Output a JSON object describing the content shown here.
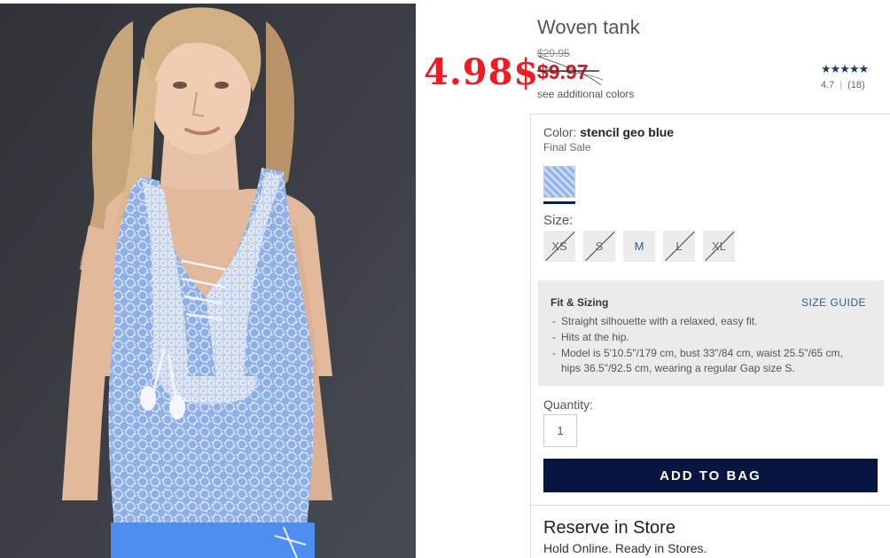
{
  "product": {
    "title": "Woven tank",
    "original_price": "$29.95",
    "sale_price": "$9.97",
    "handwritten_price": "4.98$",
    "additional_colors_link": "see additional colors",
    "rating": {
      "stars_value": 4.7,
      "stars_display": "★★★★★",
      "score": "4.7",
      "count": "(18)"
    }
  },
  "color": {
    "label": "Color:",
    "name": "stencil geo blue",
    "note": "Final Sale"
  },
  "size": {
    "label": "Size:",
    "options": [
      {
        "label": "XS",
        "available": false
      },
      {
        "label": "S",
        "available": false
      },
      {
        "label": "M",
        "available": true
      },
      {
        "label": "L",
        "available": false
      },
      {
        "label": "XL",
        "available": false
      }
    ]
  },
  "fit": {
    "title": "Fit & Sizing",
    "size_guide": "SIZE GUIDE",
    "items": [
      "Straight silhouette with a relaxed, easy fit.",
      "Hits at the hip.",
      "Model is 5'10.5\"/179 cm, bust 33\"/84 cm, waist 25.5\"/65 cm, hips 36.5\"/92.5 cm, wearing a regular Gap size S."
    ]
  },
  "quantity": {
    "label": "Quantity:",
    "value": "1"
  },
  "add_to_bag": "ADD TO BAG",
  "reserve": {
    "title": "Reserve in Store",
    "subtitle": "Hold Online. Ready in Stores."
  },
  "colors": {
    "sale_red": "#d2141b",
    "brand_navy": "#061640",
    "link_blue": "#2b5f8a",
    "handwriting_red": "#ec1c24"
  }
}
